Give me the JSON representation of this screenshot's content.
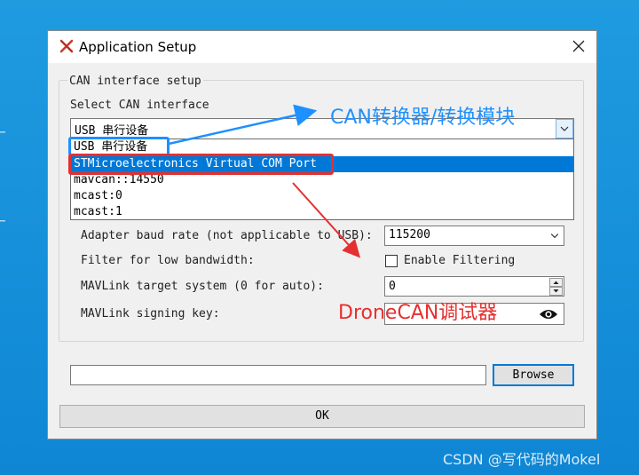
{
  "window": {
    "title": "Application Setup",
    "close_icon": "close-icon"
  },
  "group": {
    "title": "CAN interface setup"
  },
  "interface": {
    "label": "Select CAN interface",
    "selected_value": "USB 串行设备",
    "options": [
      "USB 串行设备",
      "STMicroelectronics Virtual COM Port",
      "mavcan::14550",
      "mcast:0",
      "mcast:1"
    ],
    "highlighted_index": 1
  },
  "baud": {
    "label": "Adapter baud rate (not applicable to USB):",
    "value": "115200"
  },
  "filter": {
    "label": "Filter for low bandwidth:",
    "checkbox_label": "Enable Filtering",
    "checked": false
  },
  "mavlink_target": {
    "label": "MAVLink target system (0 for auto):",
    "value": "0"
  },
  "mavlink_key": {
    "label": "MAVLink signing key:",
    "value": ""
  },
  "file": {
    "value": "",
    "browse_label": "Browse"
  },
  "ok_label": "OK",
  "annotations": {
    "top": "CAN转换器/转换模块",
    "bottom": "DroneCAN调试器",
    "blue": "#1e90ff",
    "red": "#e53030"
  },
  "watermark": "CSDN @写代码的Mokel",
  "colors": {
    "desktop": "#1a8fd8",
    "selection": "#0078d7"
  }
}
